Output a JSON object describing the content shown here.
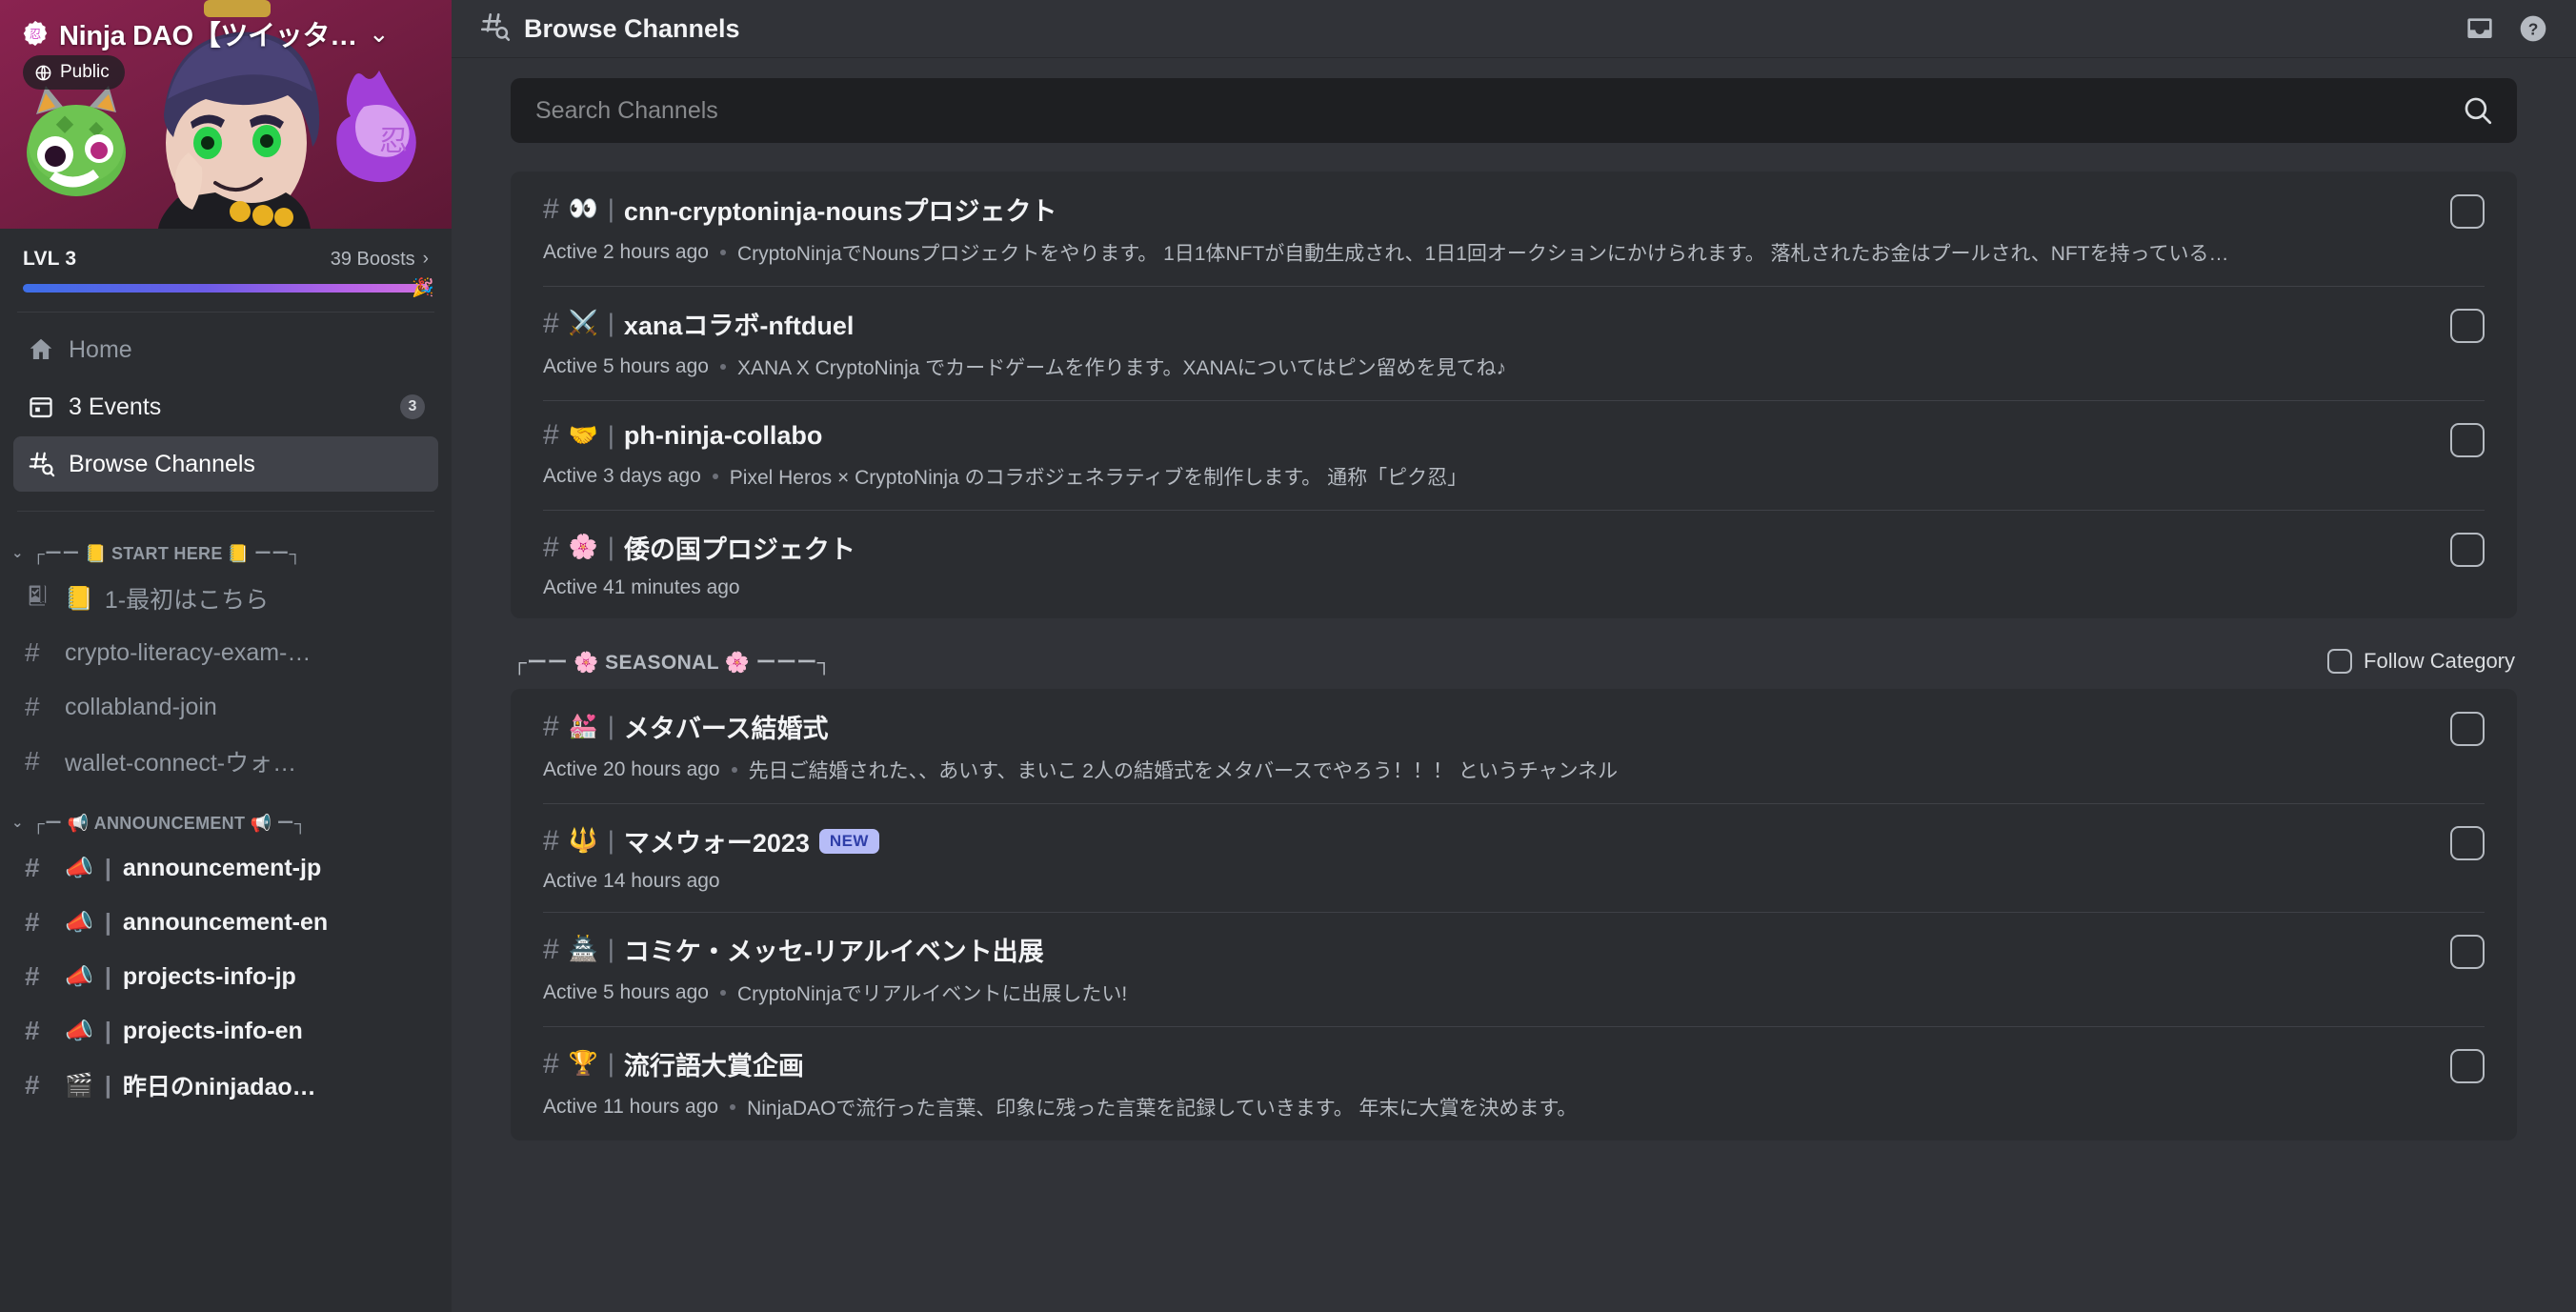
{
  "server": {
    "name": "Ninja DAO【ツイッタ…",
    "verified_icon": "verified-badge-icon",
    "privacy_label": "Public",
    "privacy_icon": "globe-icon",
    "chevron_icon": "chevron-down-icon",
    "boost_level": "LVL 3",
    "boost_count": "39 Boosts",
    "boost_chevron": "chevron-right-icon",
    "boost_spark": "🎉"
  },
  "sidebar": {
    "nav": [
      {
        "label": "Home",
        "icon": "home-icon",
        "badge": "",
        "active": false
      },
      {
        "label": "3 Events",
        "icon": "calendar-icon",
        "badge": "3",
        "active": false
      },
      {
        "label": "Browse Channels",
        "icon": "browse-channels-icon",
        "badge": "",
        "active": true
      }
    ],
    "categories": [
      {
        "label": "┌ーー 📒 START HERE 📒 ーー┐",
        "channels": [
          {
            "emoji": "📒",
            "name": "1-最初はこちら",
            "icon": "rules-channel-icon",
            "unread": false,
            "pipe": false
          },
          {
            "emoji": "",
            "name": "crypto-literacy-exam-…",
            "icon": "hash-icon",
            "unread": false,
            "pipe": false
          },
          {
            "emoji": "",
            "name": "collabland-join",
            "icon": "hash-icon",
            "unread": false,
            "pipe": false
          },
          {
            "emoji": "",
            "name": "wallet-connect-ウォ…",
            "icon": "hash-icon",
            "unread": false,
            "pipe": false
          }
        ]
      },
      {
        "label": "┌ー 📢 ANNOUNCEMENT 📢 ー┐",
        "channels": [
          {
            "emoji": "📣",
            "name": "announcement-jp",
            "icon": "hash-icon",
            "unread": true,
            "pipe": true
          },
          {
            "emoji": "📣",
            "name": "announcement-en",
            "icon": "hash-icon",
            "unread": true,
            "pipe": true
          },
          {
            "emoji": "📣",
            "name": "projects-info-jp",
            "icon": "hash-icon",
            "unread": true,
            "pipe": true
          },
          {
            "emoji": "📣",
            "name": "projects-info-en",
            "icon": "hash-icon",
            "unread": true,
            "pipe": true
          },
          {
            "emoji": "🎬",
            "name": "昨日のninjadao…",
            "icon": "hash-icon",
            "unread": true,
            "pipe": true
          }
        ]
      }
    ]
  },
  "header": {
    "title": "Browse Channels",
    "icon": "browse-channels-icon",
    "actions": [
      {
        "name": "inbox-icon"
      },
      {
        "name": "help-icon"
      }
    ]
  },
  "search": {
    "value": "",
    "placeholder": "Search Channels",
    "icon": "search-icon"
  },
  "sections": [
    {
      "title": "",
      "show_follow": false,
      "follow_label": "",
      "channels": [
        {
          "emoji": "👀",
          "name": "cnn-cryptoninja-nounsプロジェクト",
          "active": "Active 2 hours ago",
          "description": "CryptoNinjaでNounsプロジェクトをやります。 1日1体NFTが自動生成され、1日1回オークションにかけられます。 落札されたお金はプールされ、NFTを持っている…",
          "new": false
        },
        {
          "emoji": "⚔️",
          "name": "xanaコラボ-nftduel",
          "active": "Active 5 hours ago",
          "description": "XANA X CryptoNinja でカードゲームを作ります。XANAについてはピン留めを見てね♪",
          "new": false
        },
        {
          "emoji": "🤝",
          "name": "ph-ninja-collabo",
          "active": "Active 3 days ago",
          "description": "Pixel Heros × CryptoNinja のコラボジェネラティブを制作します。 通称「ピク忍」",
          "new": false
        },
        {
          "emoji": "🌸",
          "name": "倭の国プロジェクト",
          "active": "Active 41 minutes ago",
          "description": "",
          "new": false
        }
      ]
    },
    {
      "title": "┌ーー 🌸 SEASONAL 🌸 ーーー┐",
      "show_follow": true,
      "follow_label": "Follow Category",
      "channels": [
        {
          "emoji": "💒",
          "name": "メタバース結婚式",
          "active": "Active 20 hours ago",
          "description": "先日ご結婚された、、あいす、まいこ 2人の結婚式をメタバースでやろう！！！ というチャンネル",
          "new": false
        },
        {
          "emoji": "🔱",
          "name": "マメウォー2023",
          "active": "Active 14 hours ago",
          "description": "",
          "new": true,
          "new_label": "NEW"
        },
        {
          "emoji": "🏯",
          "name": "コミケ・メッセ-リアルイベント出展",
          "active": "Active 5 hours ago",
          "description": "CryptoNinjaでリアルイベントに出展したい!",
          "new": false
        },
        {
          "emoji": "🏆",
          "name": "流行語大賞企画",
          "active": "Active 11 hours ago",
          "description": "NinjaDAOで流行った言葉、印象に残った言葉を記録していきます。 年末に大賞を決めます。",
          "new": false
        }
      ]
    }
  ],
  "colors": {
    "sidebar_bg": "#2b2d31",
    "main_bg": "#313338",
    "card_bg": "#2b2d31",
    "accent": "#5865f2",
    "new_badge_bg": "#b6bcf7",
    "banner_bg": "#7a1f44"
  }
}
